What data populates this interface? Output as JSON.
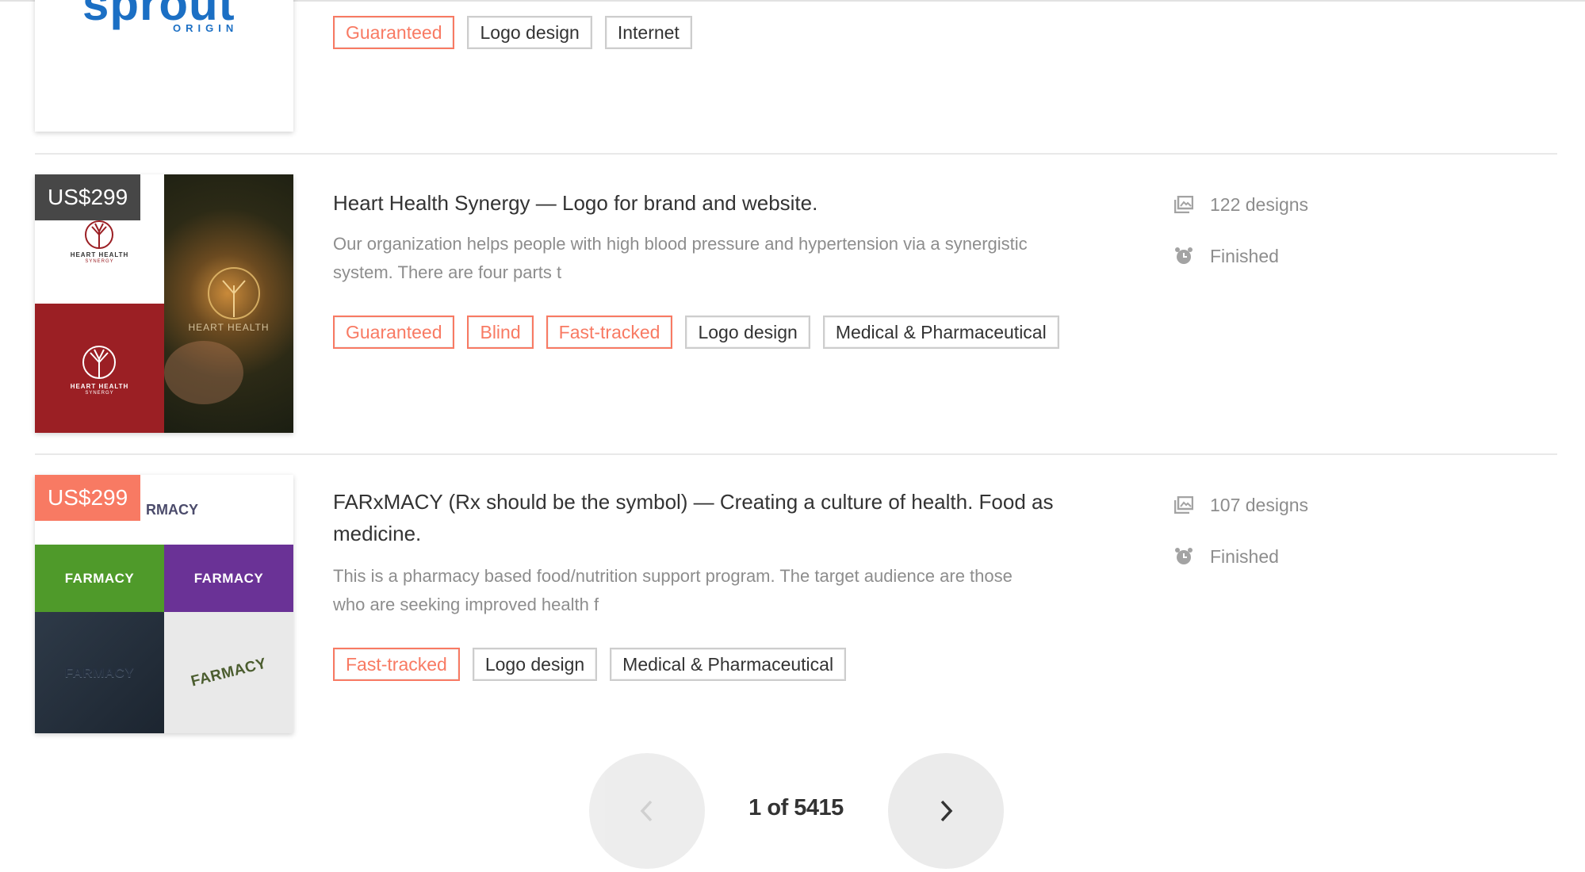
{
  "row1": {
    "logo_text": "sprout",
    "logo_sub": "ORIGIN",
    "tags": [
      {
        "label": "Guaranteed",
        "hot": true
      },
      {
        "label": "Logo design",
        "hot": false
      },
      {
        "label": "Internet",
        "hot": false
      }
    ]
  },
  "row2": {
    "price": "US$299",
    "title": "Heart Health Synergy — Logo for brand and website.",
    "description": "Our organization helps people with high blood pressure and hypertension via a synergistic system. There are four parts t",
    "logo_text": "HEART HEALTH",
    "logo_sub": "SYNERGY",
    "tags": [
      {
        "label": "Guaranteed",
        "hot": true
      },
      {
        "label": "Blind",
        "hot": true
      },
      {
        "label": "Fast-tracked",
        "hot": true
      },
      {
        "label": "Logo design",
        "hot": false
      },
      {
        "label": "Medical & Pharmaceutical",
        "hot": false
      }
    ],
    "designs": "122 designs",
    "status": "Finished"
  },
  "row3": {
    "price": "US$299",
    "title": "FARxMACY (Rx should be the symbol) — Creating a culture of health. Food as medicine.",
    "description": "This is a pharmacy based food/nutrition support program. The target audience are those who are seeking improved health f",
    "logo_text": "FARMACY",
    "logo_partial": "RMACY",
    "tags": [
      {
        "label": "Fast-tracked",
        "hot": true
      },
      {
        "label": "Logo design",
        "hot": false
      },
      {
        "label": "Medical & Pharmaceutical",
        "hot": false
      }
    ],
    "designs": "107 designs",
    "status": "Finished"
  },
  "pagination": {
    "text": "1 of 5415",
    "prev_icon": "chevron-left-icon",
    "next_icon": "chevron-right-icon"
  },
  "colors": {
    "accent": "#f87a63",
    "price_dark": "#474747",
    "muted_text": "#8d8d8d",
    "heart_red": "#9b1f24",
    "farmacy_green": "#4f9a2a",
    "farmacy_purple": "#6a3296"
  }
}
